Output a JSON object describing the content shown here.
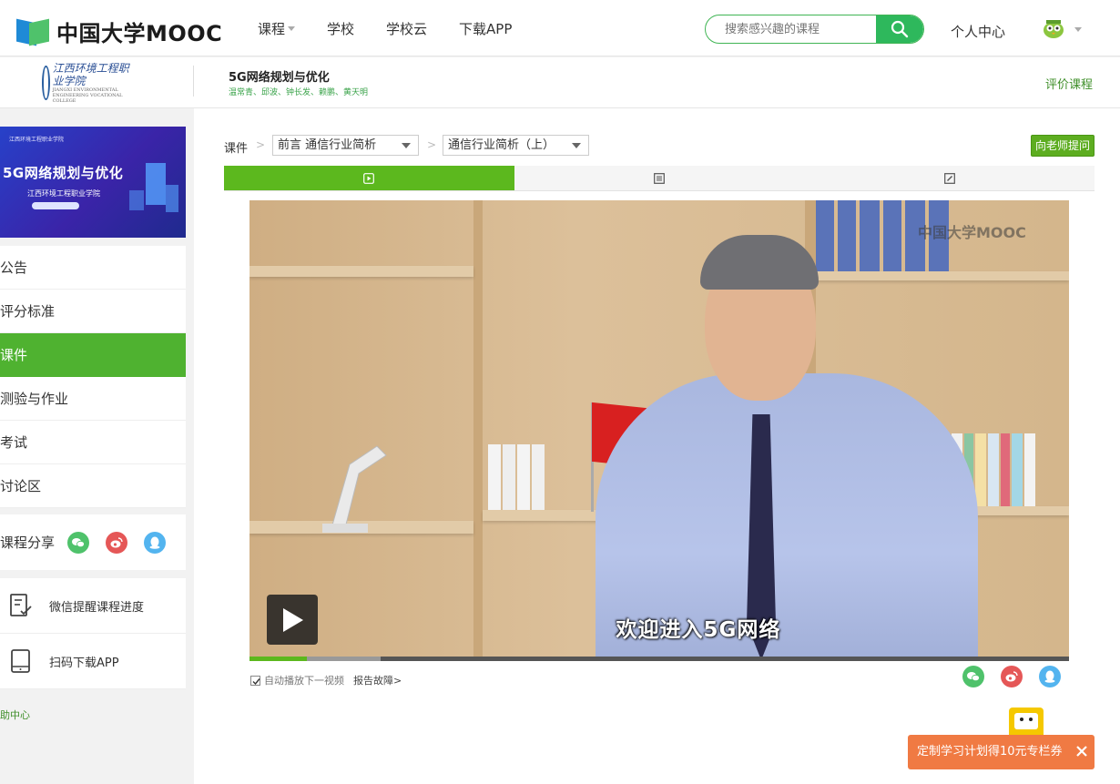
{
  "topbar": {
    "logo_text": "中国大学MOOC",
    "nav": [
      {
        "label": "课程",
        "has_caret": true
      },
      {
        "label": "学校"
      },
      {
        "label": "学校云"
      },
      {
        "label": "下载APP"
      }
    ],
    "search_placeholder": "搜索感兴趣的课程",
    "user_center": "个人中心"
  },
  "course": {
    "school_logo_text": "江西环境工程职业学院",
    "school_logo_en": "JIANGXI ENVIRONMENTAL ENGINEERING VOCATIONAL COLLEGE",
    "title": "5G网络规划与优化",
    "teachers": "温常青、邱波、钟长发、赖鹏、黄天明",
    "rate_label": "评价课程"
  },
  "sidebar": {
    "cover": {
      "top_text": "江西环境工程职业学院",
      "title": "5G网络规划与优化",
      "subtitle": "江西环境工程职业学院"
    },
    "menu": [
      {
        "label": "公告",
        "active": false
      },
      {
        "label": "评分标准",
        "active": false
      },
      {
        "label": "课件",
        "active": true
      },
      {
        "label": "测验与作业",
        "active": false
      },
      {
        "label": "考试",
        "active": false
      },
      {
        "label": "讨论区",
        "active": false
      }
    ],
    "share_label": "课程分享",
    "tools": [
      {
        "label": "微信提醒课程进度",
        "icon": "checklist-icon"
      },
      {
        "label": "扫码下载APP",
        "icon": "tablet-icon"
      }
    ],
    "help": "助中心"
  },
  "main": {
    "crumb_label": "课件",
    "chapter_select": "前言 通信行业简析",
    "lesson_select": "通信行业简析（上）",
    "ask_button": "向老师提问",
    "tabs": [
      {
        "icon": "video-icon",
        "active": true
      },
      {
        "icon": "document-icon",
        "active": false
      },
      {
        "icon": "quiz-icon",
        "active": false
      }
    ],
    "video": {
      "watermark": "中国大学MOOC",
      "subtitle": "欢迎进入5G网络",
      "played_fraction": 0.07,
      "buffered_fraction": 0.16
    },
    "autoplay_label": "自动播放下一视频",
    "autoplay_checked": true,
    "report_label": "报告故障>"
  },
  "promo": {
    "text": "定制学习计划得10元专栏券"
  },
  "colors": {
    "accent_green": "#5cb81e",
    "brand_green": "#2eb85c",
    "promo_orange": "#f07a43"
  }
}
